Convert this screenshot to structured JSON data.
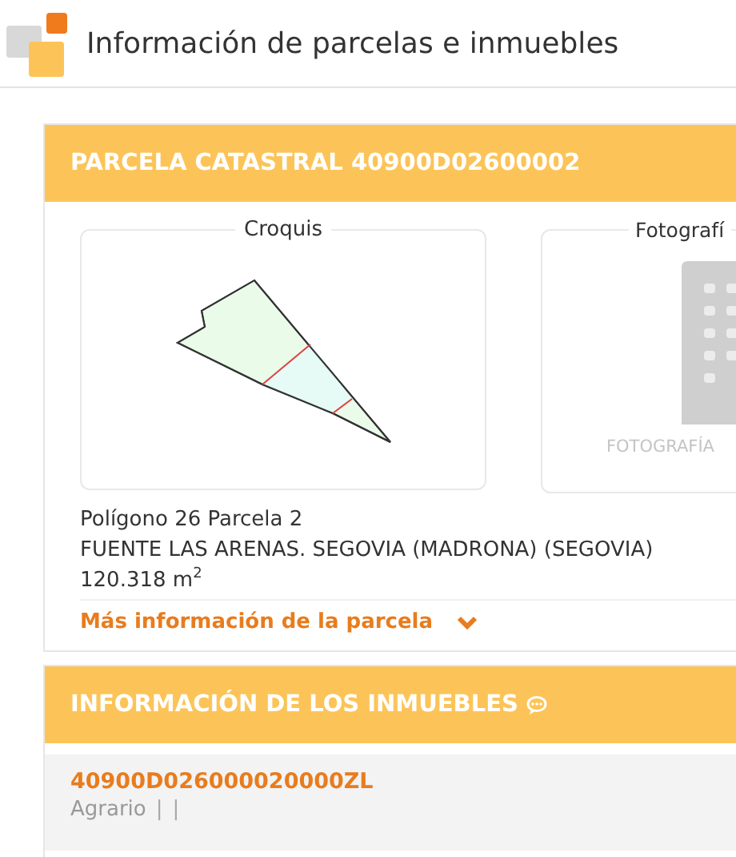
{
  "page_title": "Información de parcelas e inmuebles",
  "parcel": {
    "header": "PARCELA CATASTRAL 40900D02600002",
    "sketch": {
      "title": "Croquis"
    },
    "photo": {
      "title": "Fotografí",
      "caption": "FOTOGRAFÍA"
    },
    "location": "Polígono 26 Parcela 2",
    "address": "FUENTE LAS ARENAS. SEGOVIA (MADRONA) (SEGOVIA)",
    "area": "120.318 m$^{2}$",
    "more_link": "Más información de la parcela",
    "expanded": false
  },
  "properties": {
    "header": "INFORMACIÓN DE LOS INMUEBLES",
    "items": [
      {
        "reference": "40900D026000020000ZL",
        "use": "Agrario",
        "separators": [
          "|",
          "|"
        ]
      }
    ]
  }
}
